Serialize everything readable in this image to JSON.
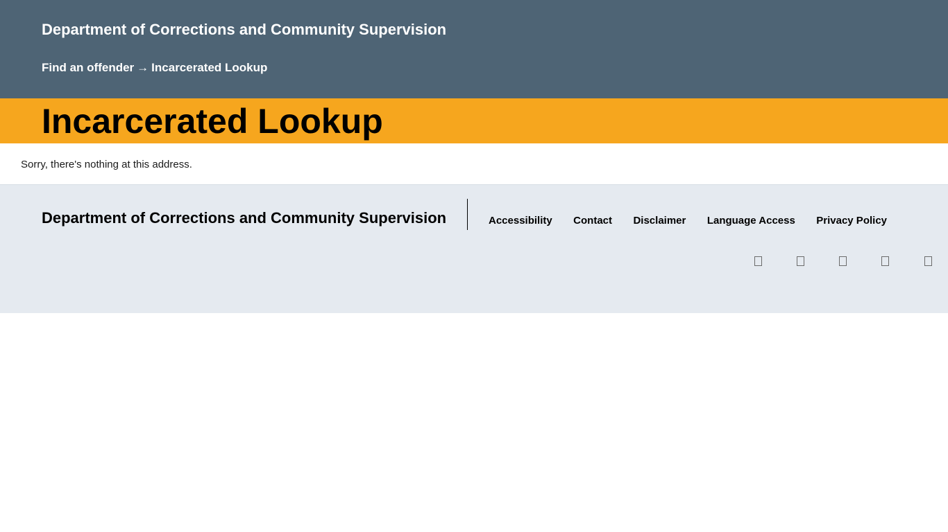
{
  "header": {
    "site_title": "Department of Corrections and Community Supervision",
    "breadcrumb": {
      "parent": "Find an offender",
      "separator": "→",
      "current": "Incarcerated Lookup"
    }
  },
  "page": {
    "title": "Incarcerated Lookup",
    "message": "Sorry, there's nothing at this address."
  },
  "footer": {
    "title": "Department of Corrections and Community Supervision",
    "links": [
      "Accessibility",
      "Contact",
      "Disclaimer",
      "Language Access",
      "Privacy Policy"
    ],
    "social_icons": [
      "social-icon-1",
      "social-icon-2",
      "social-icon-3",
      "social-icon-4",
      "social-icon-5"
    ]
  },
  "colors": {
    "header_bg": "#4e6475",
    "title_band_bg": "#f6a61e",
    "footer_bg": "#e5eaf0"
  }
}
